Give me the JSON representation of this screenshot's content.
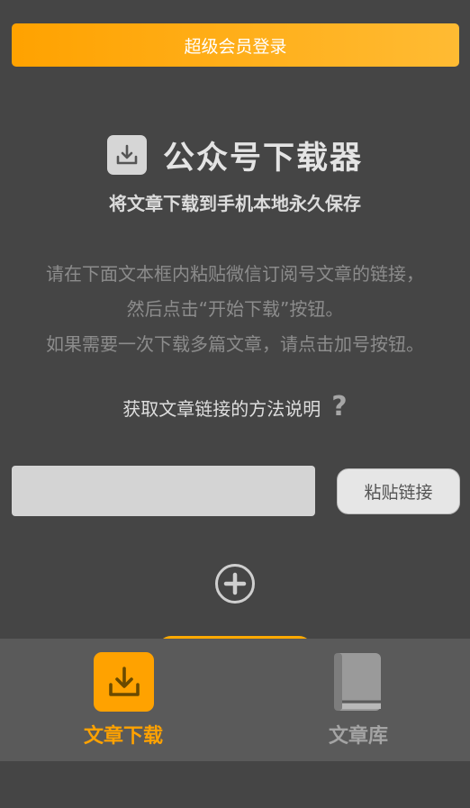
{
  "header": {
    "vip_login_label": "超级会员登录"
  },
  "hero": {
    "title": "公众号下载器",
    "subtitle": "将文章下载到手机本地永久保存"
  },
  "instructions": {
    "lines": [
      "请在下面文本框内粘贴微信订阅号文章的链接，",
      "然后点击“开始下载”按钮。",
      "如果需要一次下载多篇文章，请点击加号按钮。"
    ]
  },
  "help": {
    "method_label": "获取文章链接的方法说明",
    "icon": "question-mark-icon"
  },
  "link_form": {
    "input_value": "",
    "input_placeholder": "",
    "paste_label": "粘贴链接",
    "add_icon": "plus-circle-icon"
  },
  "tab_bar": {
    "tabs": [
      {
        "label": "文章下载",
        "icon": "download-icon",
        "active": true
      },
      {
        "label": "文章库",
        "icon": "book-icon",
        "active": false
      }
    ]
  },
  "colors": {
    "accent": "#ffa200",
    "background": "#454545",
    "tab_bar": "#5a5a5a"
  }
}
